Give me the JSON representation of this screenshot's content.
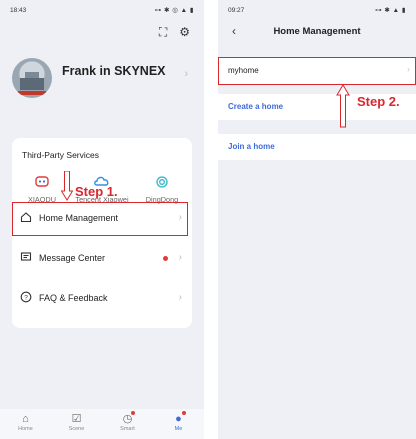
{
  "left": {
    "status": {
      "time": "18:43",
      "icons": "⊶ ✱ ◎ ▲ ▮"
    },
    "profile": {
      "name": "Frank in SKYNEX"
    },
    "third_party": {
      "title": "Third-Party Services",
      "services": [
        {
          "label": "XIAODU"
        },
        {
          "label": "Tencent Xiaowei"
        },
        {
          "label": "DingDong"
        }
      ]
    },
    "menu": [
      {
        "label": "Home Management"
      },
      {
        "label": "Message Center"
      },
      {
        "label": "FAQ & Feedback"
      }
    ],
    "step_label": "Step 1.",
    "tabs": [
      {
        "label": "Home"
      },
      {
        "label": "Scene"
      },
      {
        "label": "Smart"
      },
      {
        "label": "Me"
      }
    ]
  },
  "right": {
    "status": {
      "time": "09:27",
      "icons": "⊶ ✱ ▲ ▮"
    },
    "title": "Home Management",
    "home_name": "myhome",
    "create_label": "Create a home",
    "join_label": "Join a home",
    "step_label": "Step 2."
  },
  "colors": {
    "accent": "#3d6bd9",
    "highlight": "#d9272e",
    "background": "#eef0f5"
  }
}
